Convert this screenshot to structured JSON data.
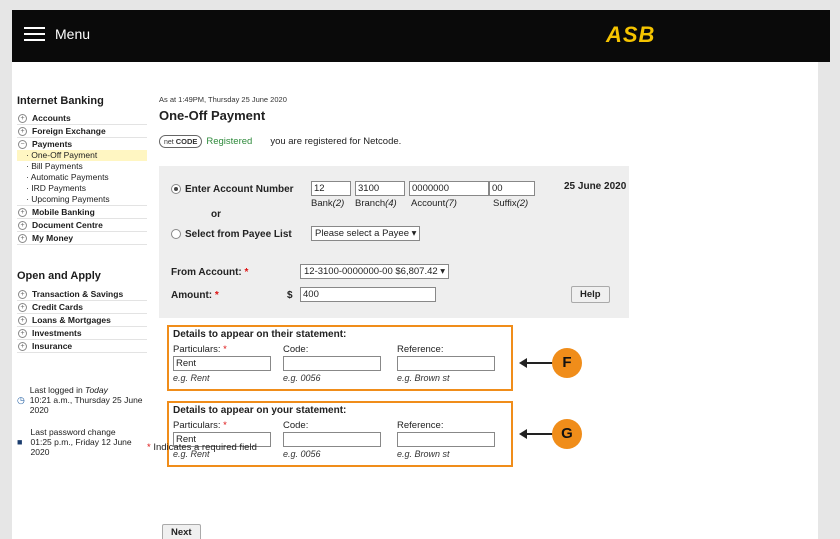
{
  "header": {
    "menu_label": "Menu",
    "logo_text": "ASB"
  },
  "sidebar": {
    "heading": "Internet Banking",
    "items": [
      {
        "label": "Accounts",
        "toggle": "+"
      },
      {
        "label": "Foreign Exchange",
        "toggle": "+"
      },
      {
        "label": "Payments",
        "toggle": "−"
      }
    ],
    "payments_sub": [
      "One-Off Payment",
      "Bill Payments",
      "Automatic Payments",
      "IRD Payments",
      "Upcoming Payments"
    ],
    "items2": [
      {
        "label": "Mobile Banking",
        "toggle": "+"
      },
      {
        "label": "Document Centre",
        "toggle": "+"
      },
      {
        "label": "My Money",
        "toggle": "+"
      }
    ],
    "heading2": "Open and Apply",
    "apply_items": [
      {
        "label": "Transaction & Savings",
        "toggle": "+"
      },
      {
        "label": "Credit Cards",
        "toggle": "+"
      },
      {
        "label": "Loans & Mortgages",
        "toggle": "+"
      },
      {
        "label": "Investments",
        "toggle": "+"
      },
      {
        "label": "Insurance",
        "toggle": "+"
      }
    ],
    "last_login": {
      "prefix": "Last logged in ",
      "today": "Today",
      "detail": "10:21 a.m., Thursday 25 June 2020"
    },
    "last_password": {
      "label": "Last password change",
      "detail": "01:25 p.m., Friday 12 June 2020"
    }
  },
  "main": {
    "as_at": "As at 1:49PM, Thursday 25 June 2020",
    "title": "One-Off Payment",
    "netcode_logo": "net",
    "netcode_logo_b": "CODE",
    "registered": "Registered",
    "netcode_text": "you are registered for Netcode.",
    "enter_account_label": "Enter Account Number",
    "or_label": "or",
    "payee_list_label": "Select from Payee List",
    "account": {
      "bank": "12",
      "branch": "3100",
      "account": "0000000",
      "suffix": "00"
    },
    "account_sub": {
      "bank": "Bank",
      "bank_n": "(2)",
      "branch": "Branch",
      "branch_n": "(4)",
      "account": "Account",
      "account_n": "(7)",
      "suffix": "Suffix",
      "suffix_n": "(2)"
    },
    "date": "25 June 2020",
    "payee_select": "Please select a Payee ▾",
    "from_account_label": "From Account:",
    "from_account_value": "12-3100-0000000-00   $6,807.42 ▾",
    "amount_label": "Amount:",
    "amount_currency": "$",
    "amount_value": "400",
    "help_label": "Help",
    "required_mark": "*"
  },
  "their": {
    "title": "Details to appear on their statement:",
    "particulars_label": "Particulars:",
    "code_label": "Code:",
    "reference_label": "Reference:",
    "particulars_value": "Rent",
    "code_value": "",
    "reference_value": "",
    "hint_particulars": "e.g. Rent",
    "hint_code": "e.g. 0056",
    "hint_reference": "e.g. Brown st"
  },
  "yours": {
    "title": "Details to appear on your statement:",
    "particulars_label": "Particulars:",
    "code_label": "Code:",
    "reference_label": "Reference:",
    "particulars_value": "Rent",
    "code_value": "",
    "reference_value": "",
    "hint_particulars": "e.g. Rent",
    "hint_code": "e.g. 0056",
    "hint_reference": "e.g. Brown st"
  },
  "callouts": {
    "f": "F",
    "g": "G"
  },
  "footer": {
    "required_note": "Indicates a required field",
    "next_label": "Next"
  }
}
